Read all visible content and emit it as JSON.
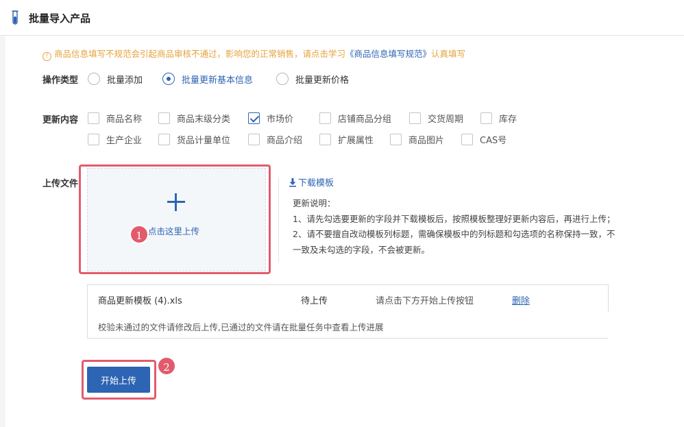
{
  "header": {
    "title": "批量导入产品",
    "icon": "test-tube-icon",
    "accent": "#2d64b3"
  },
  "notice": {
    "icon": "info-circle-icon",
    "text_before": "商品信息填写不规范会引起商品审核不通过，影响您的正常销售，请点击学习",
    "link_text": "《商品信息填写规范》",
    "text_after": "认真填写",
    "color": "#e6a23c"
  },
  "operation": {
    "label": "操作类型",
    "options": [
      {
        "label": "批量添加",
        "selected": false
      },
      {
        "label": "批量更新基本信息",
        "selected": true
      },
      {
        "label": "批量更新价格",
        "selected": false
      }
    ]
  },
  "update_content": {
    "label": "更新内容",
    "fields": [
      {
        "label": "商品名称",
        "checked": false
      },
      {
        "label": "商品末级分类",
        "checked": false
      },
      {
        "label": "市场价",
        "checked": true
      },
      {
        "label": "店铺商品分组",
        "checked": false
      },
      {
        "label": "交货周期",
        "checked": false
      },
      {
        "label": "库存",
        "checked": false
      },
      {
        "label": "生产企业",
        "checked": false
      },
      {
        "label": "货品计量单位",
        "checked": false
      },
      {
        "label": "商品介绍",
        "checked": false
      },
      {
        "label": "扩展属性",
        "checked": false
      },
      {
        "label": "商品图片",
        "checked": false
      },
      {
        "label": "CAS号",
        "checked": false
      }
    ]
  },
  "upload": {
    "label": "上传文件",
    "area_text": "点击这里上传",
    "plus_icon": "plus-icon",
    "download_icon": "download-icon",
    "download_text": "下载模板",
    "note_title": "更新说明：",
    "note_1": "1、请先勾选要更新的字段并下载模板后，按照模板整理好更新内容后，再进行上传；",
    "note_2": "2、请不要擅自改动模板列标题，需确保模板中的列标题和勾选项的名称保持一致，不一致及未勾选的字段，不会被更新。"
  },
  "file_table": {
    "file_name": "商品更新模板 (4).xls",
    "status": "待上传",
    "status_hint": "请点击下方开始上传按钮",
    "delete_label": "删除",
    "hint": "校验未通过的文件请修改后上传,已通过的文件请在批量任务中查看上传进展"
  },
  "start_button": {
    "label": "开始上传"
  },
  "annotations": {
    "badge_1": "1",
    "badge_2": "2",
    "highlight_color": "#e25b6c"
  }
}
